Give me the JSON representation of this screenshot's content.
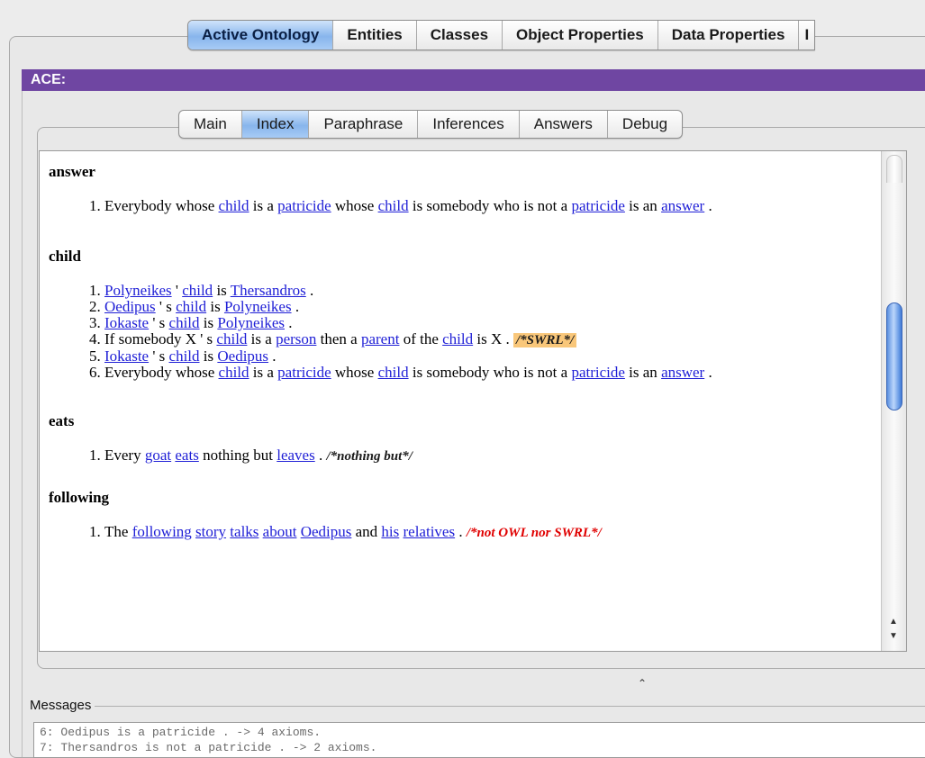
{
  "top_tabs": [
    {
      "label": "Active Ontology",
      "active": true
    },
    {
      "label": "Entities",
      "active": false
    },
    {
      "label": "Classes",
      "active": false
    },
    {
      "label": "Object Properties",
      "active": false
    },
    {
      "label": "Data Properties",
      "active": false
    },
    {
      "label": "I",
      "active": false
    }
  ],
  "ace_title": "ACE:",
  "sub_tabs": [
    {
      "label": "Main",
      "active": false
    },
    {
      "label": "Index",
      "active": true
    },
    {
      "label": "Paraphrase",
      "active": false
    },
    {
      "label": "Inferences",
      "active": false
    },
    {
      "label": "Answers",
      "active": false
    },
    {
      "label": "Debug",
      "active": false
    }
  ],
  "index": {
    "answer": {
      "title": "answer",
      "i1": {
        "t1": "Everybody whose ",
        "l1": "child",
        "t2": " is a ",
        "l2": "patricide",
        "t3": " whose ",
        "l3": "child",
        "t4": " is somebody who is not a ",
        "l4": "patricide",
        "t5": " is an ",
        "l5": "answer",
        "t6": " ."
      }
    },
    "child": {
      "title": "child",
      "i1": {
        "l1": "Polyneikes",
        "t1": " ' ",
        "l2": "child",
        "t2": " is ",
        "l3": "Thersandros",
        "t3": " ."
      },
      "i2": {
        "l1": "Oedipus",
        "t1": " ' s ",
        "l2": "child",
        "t2": " is ",
        "l3": "Polyneikes",
        "t3": " ."
      },
      "i3": {
        "l1": "Iokaste",
        "t1": " ' s ",
        "l2": "child",
        "t2": " is ",
        "l3": "Polyneikes",
        "t3": " ."
      },
      "i4": {
        "t1": "If somebody X ' s ",
        "l1": "child",
        "t2": " is a ",
        "l2": "person",
        "t3": " then a ",
        "l3": "parent",
        "t4": " of the ",
        "l4": "child",
        "t5": " is X . ",
        "comment": "/*SWRL*/"
      },
      "i5": {
        "l1": "Iokaste",
        "t1": " ' s ",
        "l2": "child",
        "t2": " is ",
        "l3": "Oedipus",
        "t3": " ."
      },
      "i6": {
        "t1": "Everybody whose ",
        "l1": "child",
        "t2": " is a ",
        "l2": "patricide",
        "t3": " whose ",
        "l3": "child",
        "t4": " is somebody who is not a ",
        "l4": "patricide",
        "t5": " is an ",
        "l5": "answer",
        "t6": " ."
      }
    },
    "eats": {
      "title": "eats",
      "i1": {
        "t1": "Every ",
        "l1": "goat",
        "t2": " ",
        "l2": "eats",
        "t3": " nothing but ",
        "l3": "leaves",
        "t4": " . ",
        "comment": "/*nothing but*/"
      }
    },
    "following": {
      "title": "following",
      "i1": {
        "t1": "The ",
        "l1": "following",
        "t2": " ",
        "l2": "story",
        "t3": " ",
        "l3": "talks",
        "t4": " ",
        "l4": "about",
        "t5": " ",
        "l5": "Oedipus",
        "t6": " and ",
        "l6": "his",
        "t7": " ",
        "l7": "relatives",
        "t8": " . ",
        "comment": "/*not OWL nor SWRL*/"
      }
    }
  },
  "messages": {
    "label": "Messages",
    "lines": [
      "6: Oedipus is a patricide .  -> 4 axioms.",
      "7: Thersandros is not a patricide .  -> 2 axioms."
    ]
  },
  "colors": {
    "ace_bar": "#6f46a2",
    "link": "#1f1fd6",
    "swrl_highlight": "#f9c77a",
    "not_owl_comment": "#e00000",
    "active_tab": "#88b5ec"
  },
  "icons": {
    "collapse": "caret-up-icon",
    "scroll_up": "arrow-up-icon",
    "scroll_down": "arrow-down-icon"
  }
}
